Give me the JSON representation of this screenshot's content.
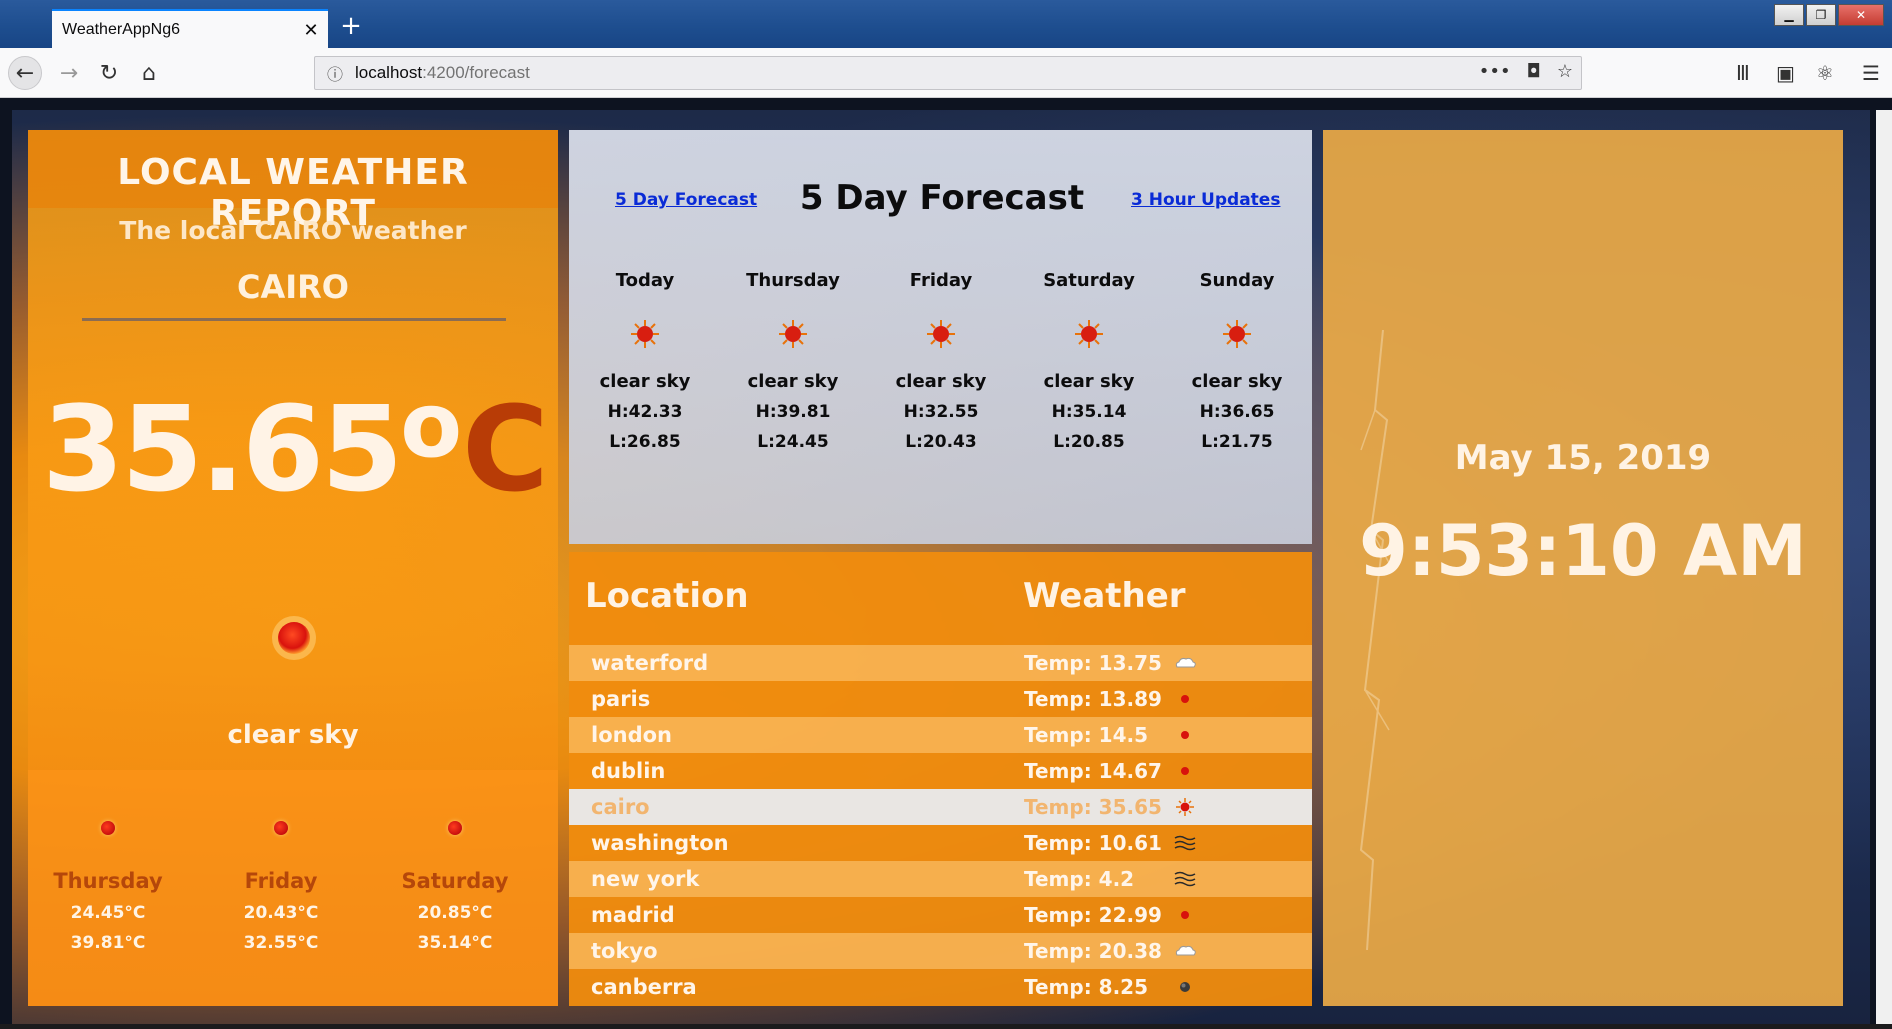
{
  "browser": {
    "tab_title": "WeatherAppNg6",
    "url_host": "localhost",
    "url_rest": ":4200/forecast"
  },
  "left_panel": {
    "title": "LOCAL WEATHER REPORT",
    "subtitle": "The local CAIRO weather",
    "city": "CAIRO",
    "temperature": "35.65",
    "degree_symbol": "o",
    "unit": "C",
    "condition": "clear sky",
    "mini_forecast": [
      {
        "day": "Thursday",
        "temp_low": "24.45°C",
        "temp_high": "39.81°C"
      },
      {
        "day": "Friday",
        "temp_low": "20.43°C",
        "temp_high": "32.55°C"
      },
      {
        "day": "Saturday",
        "temp_low": "20.85°C",
        "temp_high": "35.14°C"
      }
    ]
  },
  "forecast_panel": {
    "link_5day": "5 Day Forecast",
    "title": "5 Day Forecast",
    "link_3hour": "3 Hour Updates",
    "days": [
      {
        "day": "Today",
        "summary": "clear sky",
        "high": "H:42.33",
        "low": "L:26.85",
        "icon": "sun-icon"
      },
      {
        "day": "Thursday",
        "summary": "clear sky",
        "high": "H:39.81",
        "low": "L:24.45",
        "icon": "sun-icon"
      },
      {
        "day": "Friday",
        "summary": "clear sky",
        "high": "H:32.55",
        "low": "L:20.43",
        "icon": "sun-icon"
      },
      {
        "day": "Saturday",
        "summary": "clear sky",
        "high": "H:35.14",
        "low": "L:20.85",
        "icon": "sun-icon"
      },
      {
        "day": "Sunday",
        "summary": "clear sky",
        "high": "H:36.65",
        "low": "L:21.75",
        "icon": "sun-icon"
      }
    ]
  },
  "location_panel": {
    "header_location": "Location",
    "header_weather": "Weather",
    "rows": [
      {
        "city": "waterford",
        "temp": "Temp: 13.75",
        "icon": "cloud-icon"
      },
      {
        "city": "paris",
        "temp": "Temp: 13.89",
        "icon": "red-dot-icon"
      },
      {
        "city": "london",
        "temp": "Temp: 14.5",
        "icon": "red-dot-icon"
      },
      {
        "city": "dublin",
        "temp": "Temp: 14.67",
        "icon": "red-dot-icon"
      },
      {
        "city": "cairo",
        "temp": "Temp: 35.65",
        "icon": "sun-icon"
      },
      {
        "city": "washington",
        "temp": "Temp: 10.61",
        "icon": "mist-icon"
      },
      {
        "city": "new york",
        "temp": "Temp: 4.2",
        "icon": "mist-icon"
      },
      {
        "city": "madrid",
        "temp": "Temp: 22.99",
        "icon": "red-dot-icon"
      },
      {
        "city": "tokyo",
        "temp": "Temp: 20.38",
        "icon": "cloud-icon"
      },
      {
        "city": "canberra",
        "temp": "Temp: 8.25",
        "icon": "dark-moon-icon"
      }
    ],
    "selected_city": "cairo"
  },
  "clock_panel": {
    "date": "May 15, 2019",
    "time": "9:53:10 AM"
  }
}
